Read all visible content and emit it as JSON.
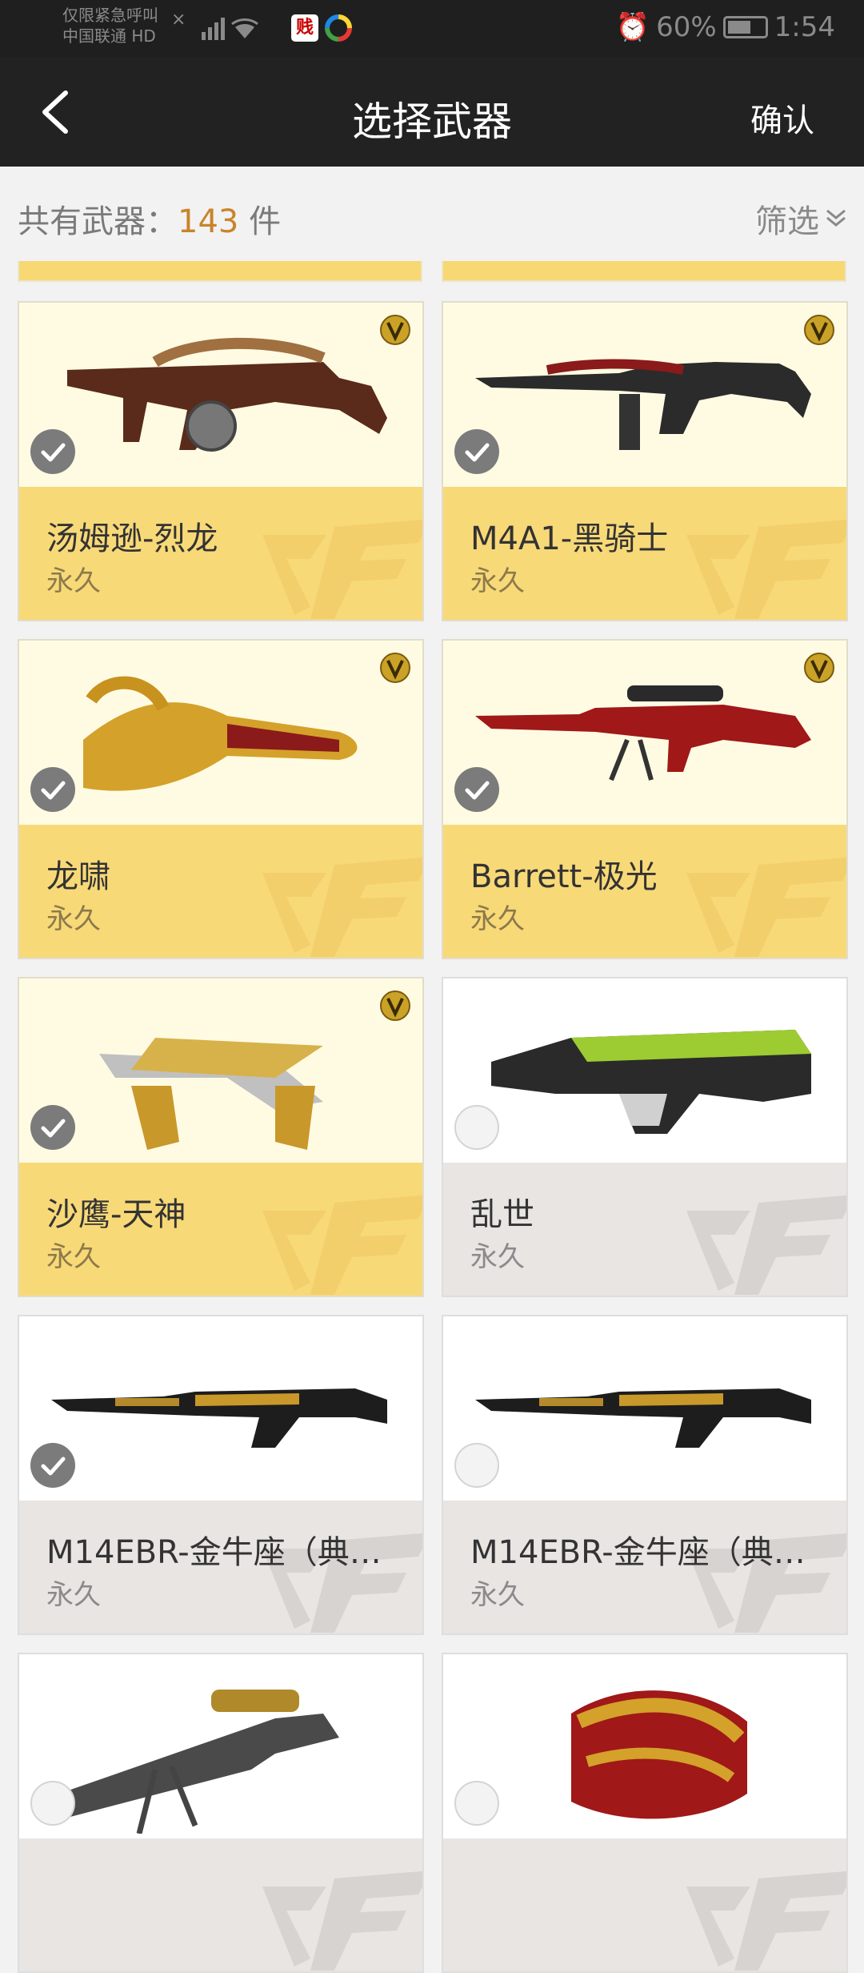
{
  "status_bar": {
    "carrier_line1": "仅限紧急呼叫",
    "carrier_line2": "中国联通 HD",
    "battery": "60%",
    "time": "1:54"
  },
  "nav": {
    "title": "选择武器",
    "confirm": "确认"
  },
  "summary": {
    "prefix": "共有武器：",
    "count": "143",
    "unit": "件",
    "filter": "筛选"
  },
  "weapons": [
    {
      "name": "汤姆逊-烈龙",
      "term": "永久",
      "selected": true,
      "vip": true,
      "style": "gold"
    },
    {
      "name": "M4A1-黑骑士",
      "term": "永久",
      "selected": true,
      "vip": true,
      "style": "gold"
    },
    {
      "name": "龙啸",
      "term": "永久",
      "selected": true,
      "vip": true,
      "style": "gold"
    },
    {
      "name": "Barrett-极光",
      "term": "永久",
      "selected": true,
      "vip": true,
      "style": "gold"
    },
    {
      "name": "沙鹰-天神",
      "term": "永久",
      "selected": true,
      "vip": true,
      "style": "gold"
    },
    {
      "name": "乱世",
      "term": "永久",
      "selected": false,
      "vip": false,
      "style": "grey"
    },
    {
      "name": "M14EBR-金牛座（典藏...",
      "term": "永久",
      "selected": true,
      "vip": false,
      "style": "grey"
    },
    {
      "name": "M14EBR-金牛座（典藏...",
      "term": "永久",
      "selected": false,
      "vip": false,
      "style": "grey"
    },
    {
      "name": "",
      "term": "",
      "selected": false,
      "vip": false,
      "style": "grey"
    },
    {
      "name": "",
      "term": "",
      "selected": false,
      "vip": false,
      "style": "grey"
    }
  ]
}
